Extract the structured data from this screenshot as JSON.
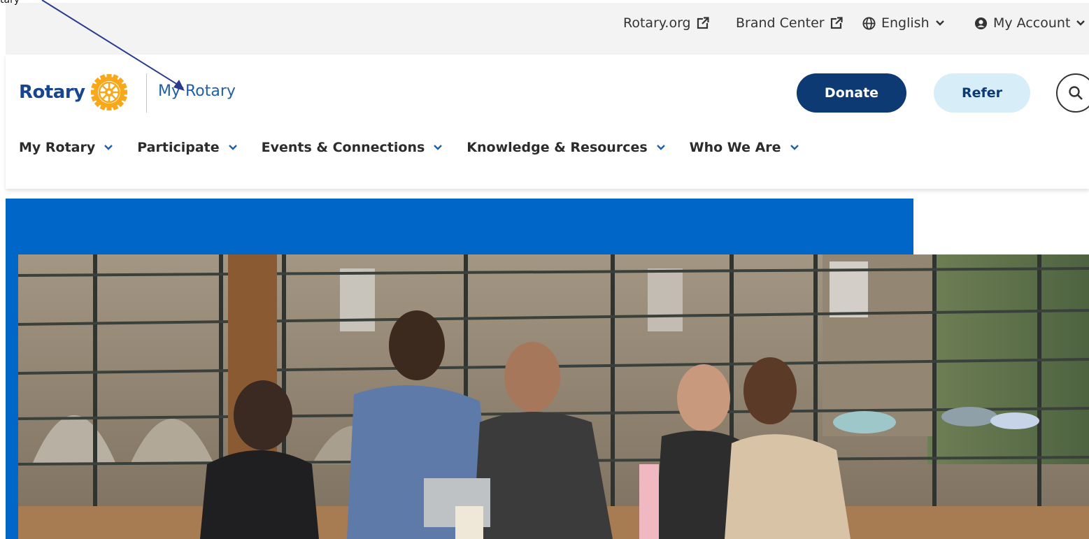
{
  "utility_nav": {
    "rotary_org": "Rotary.org",
    "brand_center": "Brand Center",
    "language": "English",
    "account": "My Account"
  },
  "header": {
    "logo_text": "Rotary",
    "section_link": "My Rotary",
    "donate_label": "Donate",
    "refer_label": "Refer"
  },
  "main_nav": [
    {
      "label": "My Rotary"
    },
    {
      "label": "Participate"
    },
    {
      "label": "Events & Connections"
    },
    {
      "label": "Knowledge & Resources"
    },
    {
      "label": "Who We Are"
    }
  ],
  "annotation": {
    "label": "tary"
  },
  "colors": {
    "brand_blue": "#17458f",
    "donate_bg": "#0e3a73",
    "refer_bg": "#d7eef9",
    "hero_blue": "#0067c8",
    "gold": "#f7a81b"
  },
  "icons": {
    "external": "external-link-icon",
    "globe": "globe-icon",
    "account": "user-circle-icon",
    "chevron": "chevron-down-icon",
    "search": "search-icon",
    "wheel": "rotary-wheel-icon"
  }
}
